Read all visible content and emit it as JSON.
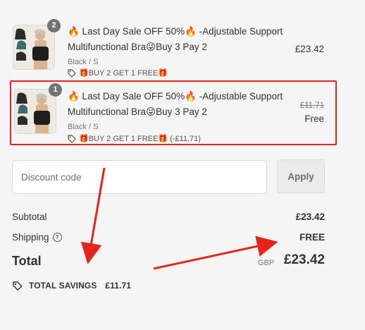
{
  "line_items": [
    {
      "quantity": "2",
      "title": "🔥 Last Day Sale OFF 50%🔥 -Adjustable Support Multifunctional Bra😜Buy 3 Pay 2",
      "variant": "Black / S",
      "promo": "🎁BUY 2 GET 1 FREE🎁",
      "price": "£23.42"
    },
    {
      "quantity": "1",
      "title": "🔥 Last Day Sale OFF 50%🔥 -Adjustable Support Multifunctional Bra😜Buy 3 Pay 2",
      "variant": "Black / S",
      "promo": "🎁BUY 2 GET 1 FREE🎁 (-£11.71)",
      "original_price": "£11.71",
      "price": "Free"
    }
  ],
  "discount": {
    "placeholder": "Discount code",
    "apply_label": "Apply"
  },
  "summary": {
    "subtotal_label": "Subtotal",
    "subtotal_value": "£23.42",
    "shipping_label": "Shipping",
    "shipping_value": "FREE",
    "total_label": "Total",
    "currency": "GBP",
    "total_value": "£23.42",
    "savings_label": "TOTAL SAVINGS",
    "savings_value": "£11.71"
  },
  "colors": {
    "highlight": "#e5251c",
    "background": "#f5f5f5"
  },
  "icons": [
    "tag-icon",
    "help-circle-icon",
    "savings-tag-icon",
    "red-arrow"
  ]
}
